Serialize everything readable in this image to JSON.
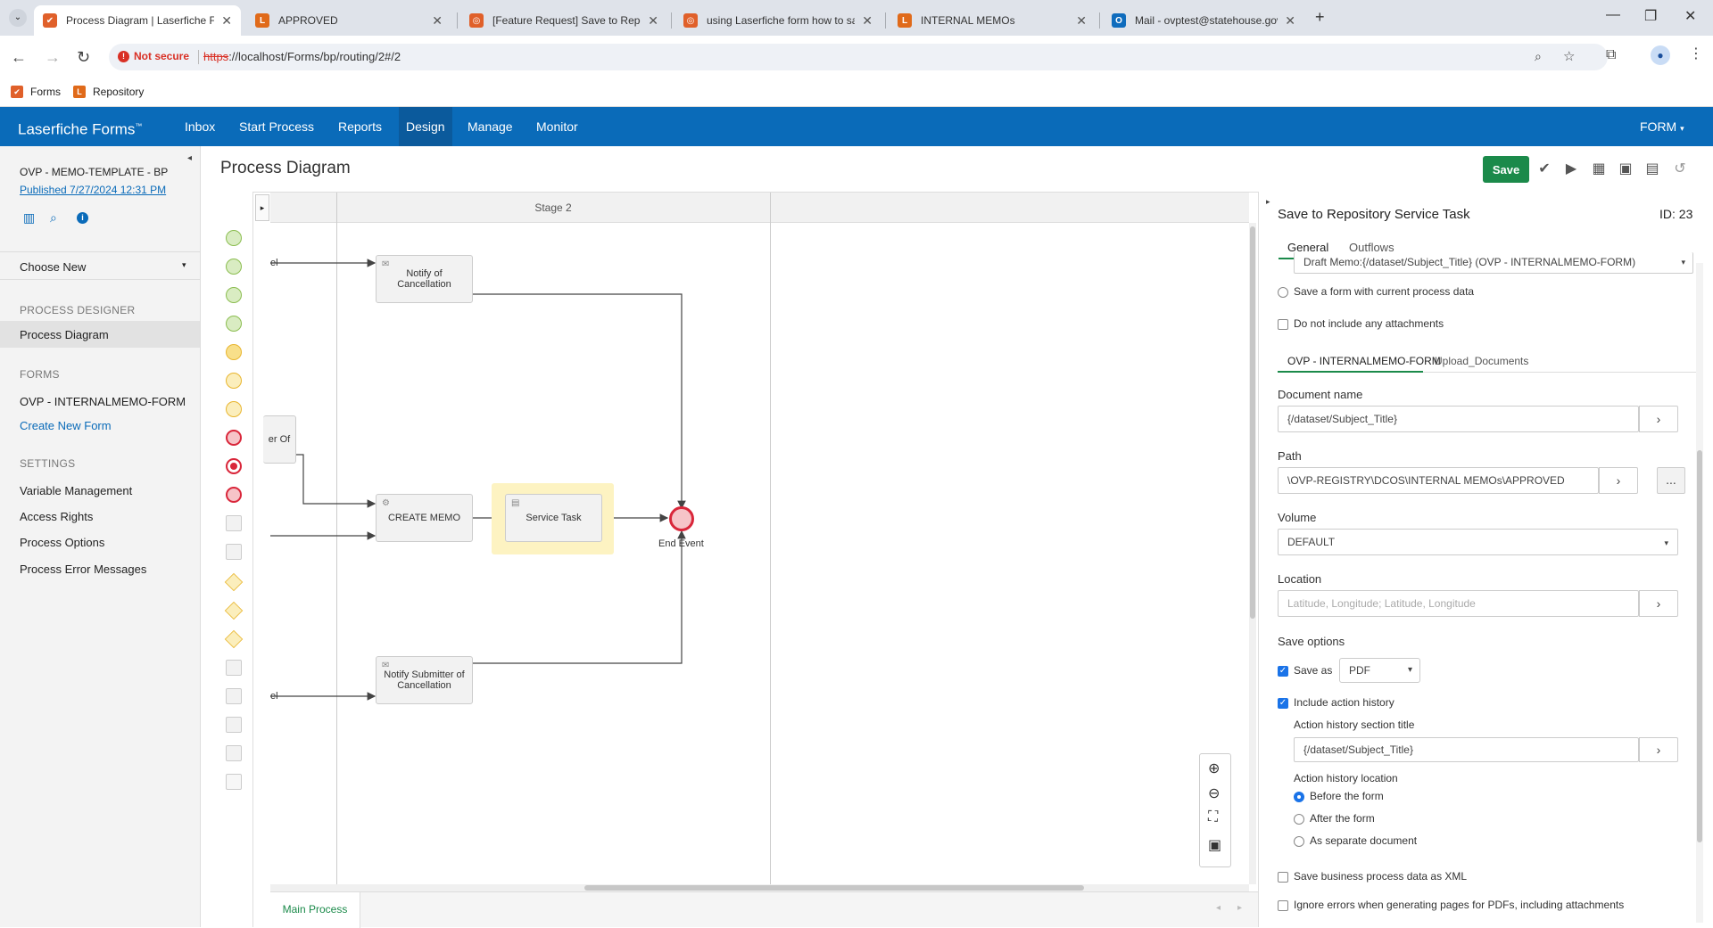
{
  "browser": {
    "tabs": [
      {
        "title": "Process Diagram | Laserfiche Fo",
        "fav_color": "#e0602a",
        "fav_glyph": "✔"
      },
      {
        "title": "APPROVED",
        "fav_color": "#e06a1a",
        "fav_glyph": "L"
      },
      {
        "title": "[Feature Request] Save to Repo",
        "fav_color": "#e0602a",
        "fav_glyph": "◎"
      },
      {
        "title": "using Laserfiche form how to sa",
        "fav_color": "#e0602a",
        "fav_glyph": "◎"
      },
      {
        "title": "INTERNAL MEMOs",
        "fav_color": "#e06a1a",
        "fav_glyph": "L"
      },
      {
        "title": "Mail - ovptest@statehouse.gov",
        "fav_color": "#0f6cbd",
        "fav_glyph": "O"
      }
    ],
    "security_label": "Not secure",
    "url_scheme": "https",
    "url_rest": "://localhost/Forms/bp/routing/2#/2",
    "bookmarks": [
      {
        "label": "Forms",
        "fav_color": "#e0602a"
      },
      {
        "label": "Repository",
        "fav_color": "#e06a1a"
      }
    ]
  },
  "app": {
    "brand": "Laserfiche Forms",
    "brand_tm": "™",
    "nav": [
      "Inbox",
      "Start Process",
      "Reports",
      "Design",
      "Manage",
      "Monitor"
    ],
    "active_nav": "Design",
    "right_menu": "FORM"
  },
  "sidebar": {
    "process_name": "OVP - MEMO-TEMPLATE - BP",
    "published": "Published 7/27/2024 12:31 PM",
    "choose_new": "Choose New",
    "sections": {
      "designer_head": "PROCESS DESIGNER",
      "designer_item": "Process Diagram",
      "forms_head": "FORMS",
      "form_item": "OVP - INTERNALMEMO-FORM",
      "create_form": "Create New Form",
      "settings_head": "SETTINGS",
      "settings_items": [
        "Variable Management",
        "Access Rights",
        "Process Options",
        "Process Error Messages"
      ]
    }
  },
  "main": {
    "title": "Process Diagram",
    "save_label": "Save",
    "stage_label": "Stage 2",
    "tasks": {
      "notify_cancel": "Notify of Cancellation",
      "create_memo": "CREATE MEMO",
      "service_task": "Service Task",
      "notify_submitter": "Notify Submitter of Cancellation",
      "end_event": "End Event",
      "partial_left1": "el",
      "partial_left2": "er Of",
      "partial_left3": "el"
    },
    "bottom_tab": "Main Process"
  },
  "panel": {
    "title": "Save to Repository Service Task",
    "id_label": "ID: 23",
    "tabs": [
      "General",
      "Outflows"
    ],
    "top_select": "Draft Memo:{/dataset/Subject_Title} (OVP - INTERNALMEMO-FORM)",
    "save_form_current": "Save a form with current process data",
    "no_attachments": "Do not include any attachments",
    "form_tabs": [
      "OVP - INTERNALMEMO-FORM",
      "Upload_Documents"
    ],
    "doc_name_label": "Document name",
    "doc_name_value": "{/dataset/Subject_Title}",
    "path_label": "Path",
    "path_value": "\\OVP-REGISTRY\\DCOS\\INTERNAL MEMOs\\APPROVED",
    "path_browse": "...",
    "volume_label": "Volume",
    "volume_value": "DEFAULT",
    "location_label": "Location",
    "location_placeholder": "Latitude, Longitude; Latitude, Longitude",
    "save_options_label": "Save options",
    "save_as_label": "Save as",
    "save_as_value": "PDF",
    "include_history": "Include action history",
    "history_title_label": "Action history section title",
    "history_title_value": "{/dataset/Subject_Title}",
    "history_location_label": "Action history location",
    "history_options": [
      "Before the form",
      "After the form",
      "As separate document"
    ],
    "save_xml": "Save business process data as XML",
    "ignore_errors": "Ignore errors when generating pages for PDFs, including attachments"
  }
}
